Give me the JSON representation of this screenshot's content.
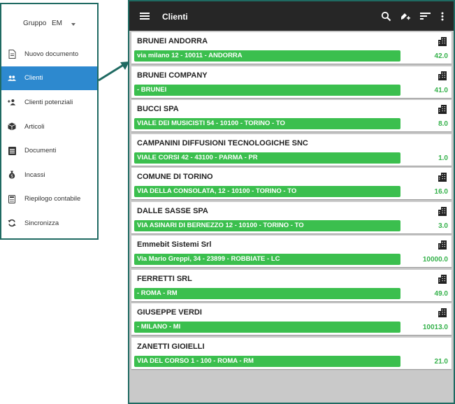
{
  "drawer": {
    "group_label": "Gruppo",
    "group_value": "EM",
    "items": [
      {
        "label": "Nuovo documento",
        "icon": "document-icon",
        "active": false
      },
      {
        "label": "Clienti",
        "icon": "people-icon",
        "active": true
      },
      {
        "label": "Clienti potenziali",
        "icon": "add-person-icon",
        "active": false
      },
      {
        "label": "Articoli",
        "icon": "box-icon",
        "active": false
      },
      {
        "label": "Documenti",
        "icon": "documents-icon",
        "active": false
      },
      {
        "label": "Incassi",
        "icon": "money-bag-icon",
        "active": false
      },
      {
        "label": "Riepilogo contabile",
        "icon": "calculator-icon",
        "active": false
      },
      {
        "label": "Sincronizza",
        "icon": "sync-icon",
        "active": false
      }
    ]
  },
  "appbar": {
    "title": "Clienti",
    "icons": [
      "menu-icon",
      "search-icon",
      "edit-add-icon",
      "sort-icon",
      "more-vert-icon"
    ]
  },
  "customers": [
    {
      "name": "BRUNEI ANDORRA",
      "address": "via milano 12 - 10011 - ANDORRA",
      "amount": "42.0",
      "building": true
    },
    {
      "name": "BRUNEI COMPANY",
      "address": "- BRUNEI",
      "amount": "41.0",
      "building": true
    },
    {
      "name": "BUCCI SPA",
      "address": "VIALE DEI MUSICISTI 54 - 10100 - TORINO - TO",
      "amount": "8.0",
      "building": true
    },
    {
      "name": "CAMPANINI DIFFUSIONI TECNOLOGICHE SNC",
      "address": "VIALE CORSI 42 - 43100 - PARMA - PR",
      "amount": "1.0",
      "building": false
    },
    {
      "name": "COMUNE DI TORINO",
      "address": "VIA DELLA CONSOLATA, 12 - 10100 - TORINO - TO",
      "amount": "16.0",
      "building": true
    },
    {
      "name": "DALLE SASSE SPA",
      "address": "VIA ASINARI DI BERNEZZO 12 - 10100 - TORINO - TO",
      "amount": "3.0",
      "building": true
    },
    {
      "name": "Emmebit Sistemi Srl",
      "address": "Via Mario Greppi, 34 - 23899 - ROBBIATE - LC",
      "amount": "10000.0",
      "building": true
    },
    {
      "name": "FERRETTI SRL",
      "address": "- ROMA - RM",
      "amount": "49.0",
      "building": true
    },
    {
      "name": "GIUSEPPE VERDI",
      "address": "- MILANO - MI",
      "amount": "10013.0",
      "building": true
    },
    {
      "name": "ZANETTI GIOIELLI",
      "address": "VIA DEL CORSO 1 - 100 - ROMA - RM",
      "amount": "21.0",
      "building": false
    }
  ],
  "colors": {
    "accent": "#2d89cf",
    "address_bar": "#3bbf4e",
    "amount": "#34b14a",
    "appbar": "#262626",
    "border": "#1f6a62"
  }
}
